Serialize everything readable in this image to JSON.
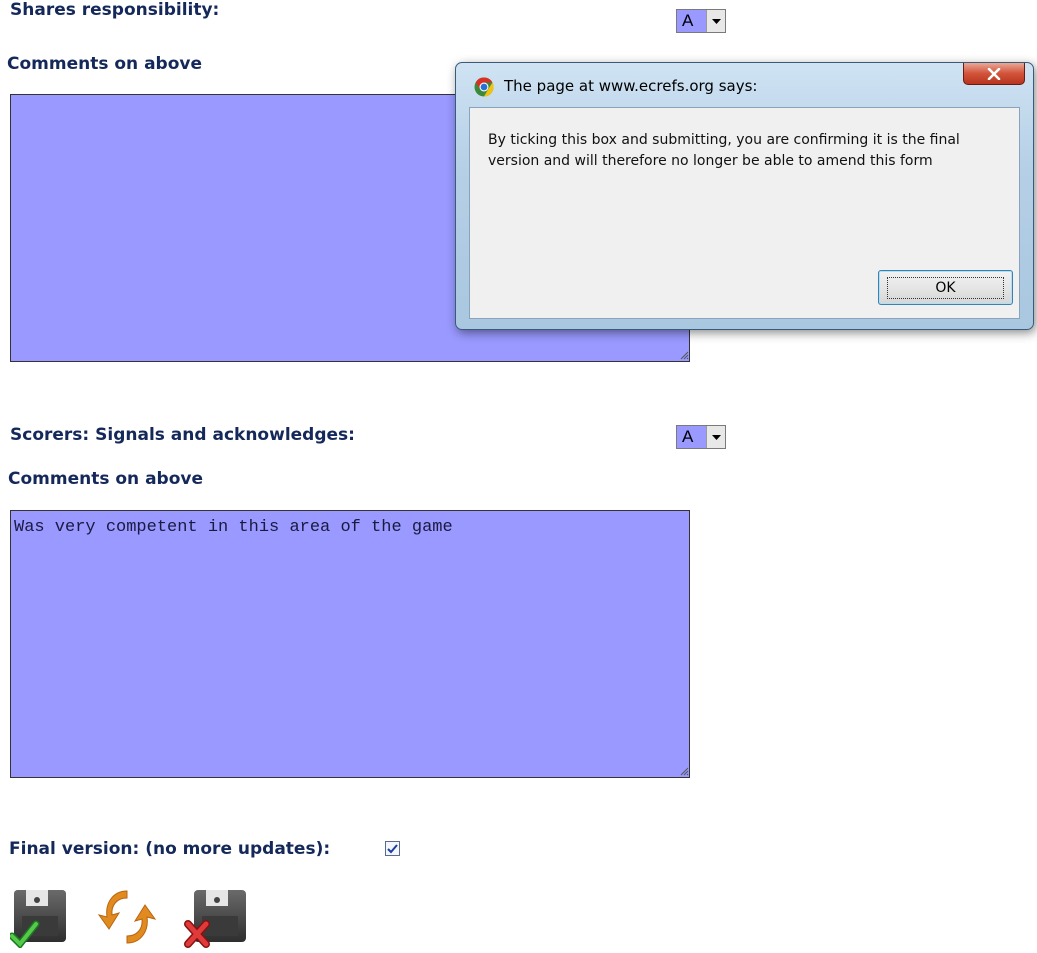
{
  "section1": {
    "label": "Shares responsibility:",
    "grade": "A",
    "comments_label": "Comments on above",
    "comments_value": ""
  },
  "section2": {
    "label": "Scorers: Signals and acknowledges:",
    "grade": "A",
    "comments_label": "Comments on above",
    "comments_value": "Was very competent in this area of the game"
  },
  "final_version": {
    "label": "Final version: (no more updates):",
    "checked": true
  },
  "actions": {
    "icons": [
      "save-confirm-icon",
      "refresh-icon",
      "save-cancel-icon"
    ]
  },
  "dialog": {
    "title": "The page at www.ecrefs.org says:",
    "message": "By ticking this box and submitting, you are confirming it is the final version and will therefore no longer be able to amend this  form",
    "ok_label": "OK"
  },
  "colors": {
    "field_bg": "#9999ff",
    "label_text": "#14285a",
    "close_button": "#c8452c"
  }
}
